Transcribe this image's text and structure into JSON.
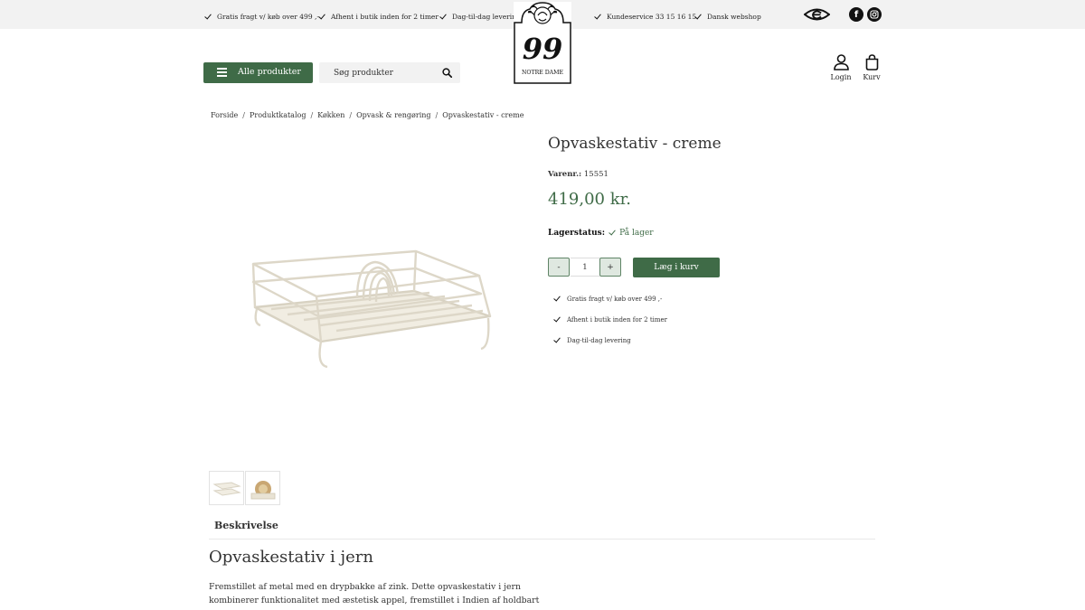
{
  "topbar": {
    "usps_left": [
      "Gratis fragt v/ køb over 499 ,-",
      "Afhent i butik inden for 2 timer",
      "Dag-til-dag levering"
    ],
    "usps_right": [
      "Kundeservice 33 15 16 15",
      "Dansk webshop"
    ],
    "icons": [
      "e-maerket-icon",
      "facebook-icon",
      "instagram-icon"
    ]
  },
  "logo": {
    "number": "99",
    "text": "NOTRE DAME"
  },
  "header": {
    "menu_label": "Alle produkter",
    "search_placeholder": "Søg produkter",
    "login_label": "Login",
    "cart_label": "Kurv"
  },
  "breadcrumb": [
    "Forside",
    "Produktkatalog",
    "Køkken",
    "Opvask & rengøring",
    "Opvaskestativ - creme"
  ],
  "product": {
    "title": "Opvaskestativ - creme",
    "sku_label": "Varenr.:",
    "sku": "15551",
    "price": "419,00 kr.",
    "stock_label": "Lagerstatus:",
    "stock_value": "På lager",
    "qty_minus": "-",
    "qty_value": "1",
    "qty_plus": "+",
    "add_to_cart": "Læg i kurv",
    "usps": [
      "Gratis fragt v/ køb over 499 ,-",
      "Afhent i butik inden for 2 timer",
      "Dag-til-dag levering"
    ]
  },
  "colors": {
    "brand_green": "#3f6b47",
    "topbar_bg": "#f2f2f2"
  },
  "description": {
    "tab_label": "Beskrivelse",
    "heading": "Opvaskestativ i jern",
    "body": "Fremstillet af metal med en drypbakke af zink. Dette opvaskestativ i jern kombinerer funktionalitet med æstetisk appel, fremstillet i Indien af holdbart jern"
  }
}
